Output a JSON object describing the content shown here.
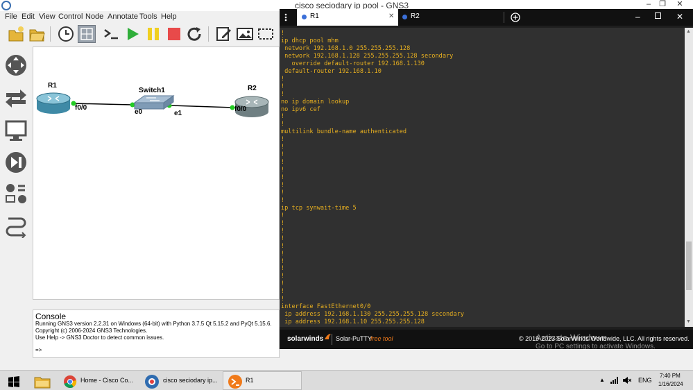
{
  "window": {
    "title": "cisco seciodary ip pool - GNS3"
  },
  "menu": [
    "File",
    "Edit",
    "View",
    "Control",
    "Node",
    "Annotate",
    "Tools",
    "Help"
  ],
  "topology": {
    "nodes": [
      {
        "id": "r1",
        "label": "R1"
      },
      {
        "id": "switch1",
        "label": "Switch1"
      },
      {
        "id": "r2",
        "label": "R2"
      }
    ],
    "ports": {
      "r1_f00": "f0/0",
      "sw_e0": "e0",
      "sw_e1": "e1",
      "r2_f00": "f0/0"
    }
  },
  "console": {
    "title": "Console",
    "lines": [
      "Running GNS3 version 2.2.31 on Windows (64-bit) with Python 3.7.5 Qt 5.15.2 and PyQt 5.15.6.",
      "Copyright (c) 2006-2024 GNS3 Technologies.",
      "Use Help -> GNS3 Doctor to detect common issues.",
      "",
      "=>"
    ]
  },
  "putty": {
    "tabs": [
      {
        "label": "R1",
        "active": true
      },
      {
        "label": "R2",
        "active": false
      }
    ],
    "terminal_lines": [
      "!",
      "ip dhcp pool mhm",
      " network 192.168.1.0 255.255.255.128",
      " network 192.168.1.128 255.255.255.128 secondary",
      "   override default-router 192.168.1.130",
      " default-router 192.168.1.10",
      "!",
      "!",
      "!",
      "no ip domain lookup",
      "no ipv6 cef",
      "!",
      "!",
      "multilink bundle-name authenticated",
      "!",
      "!",
      "!",
      "!",
      "!",
      "!",
      "!",
      "!",
      "!",
      "ip tcp synwait-time 5",
      "!",
      "!",
      "!",
      "!",
      "!",
      "!",
      "!",
      "!",
      "!",
      "!",
      "!",
      "!",
      "interface FastEthernet0/0",
      " ip address 192.168.1.130 255.255.255.128 secondary",
      " ip address 192.168.1.10 255.255.255.128"
    ],
    "footer": {
      "brand": "solarwinds",
      "product": "Solar-PuTTY",
      "edition": "free tool",
      "copyright": "© 2019-2023 SolarWinds Worldwide, LLC. All rights reserved."
    }
  },
  "watermark": {
    "line1": "Activate Windows",
    "line2": "Go to PC settings to activate Windows."
  },
  "taskbar": {
    "tasks": [
      {
        "label": "Home - Cisco Co..."
      },
      {
        "label": "cisco seciodary ip..."
      },
      {
        "label": "R1"
      }
    ],
    "language": "ENG",
    "time": "7:40 PM",
    "date": "1/16/2024"
  },
  "colors": {
    "terminal_text": "#e8b020",
    "terminal_bg": "#303030",
    "link_dot": "#22cc22",
    "tab_dot": "#3b6fd8",
    "footer_brand": "#f07a1a"
  }
}
